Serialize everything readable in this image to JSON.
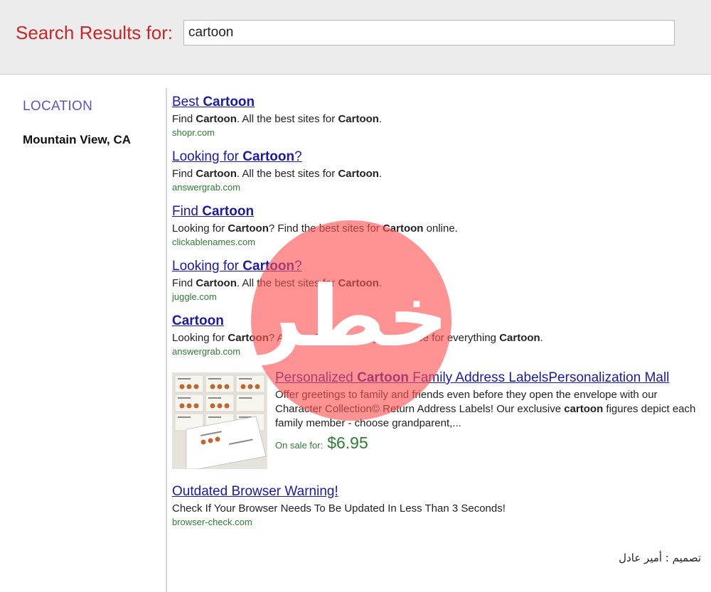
{
  "header": {
    "label": "Search Results for:",
    "query": "cartoon"
  },
  "sidebar": {
    "heading": "LOCATION",
    "location": "Mountain View, CA"
  },
  "results": [
    {
      "title_parts": [
        "Best ",
        "Cartoon",
        ""
      ],
      "desc": [
        [
          "Find ",
          false
        ],
        [
          "Cartoon",
          true
        ],
        [
          ". All the best sites for ",
          false
        ],
        [
          "Cartoon",
          true
        ],
        [
          ".",
          false
        ]
      ],
      "url": "shopr.com"
    },
    {
      "title_parts": [
        "Looking for ",
        "Cartoon",
        "?"
      ],
      "desc": [
        [
          "Find ",
          false
        ],
        [
          "Cartoon",
          true
        ],
        [
          ". All the best sites for ",
          false
        ],
        [
          "Cartoon",
          true
        ],
        [
          ".",
          false
        ]
      ],
      "url": "answergrab.com"
    },
    {
      "title_parts": [
        "Find ",
        "Cartoon",
        ""
      ],
      "desc": [
        [
          "Looking for ",
          false
        ],
        [
          "Cartoon",
          true
        ],
        [
          "? Find the best sites for ",
          false
        ],
        [
          "Cartoon",
          true
        ],
        [
          " online.",
          false
        ]
      ],
      "url": "clickablenames.com"
    },
    {
      "title_parts": [
        "Looking for ",
        "Cartoon",
        "?"
      ],
      "desc": [
        [
          "Find ",
          false
        ],
        [
          "Cartoon",
          true
        ],
        [
          ". All the best sites for ",
          false
        ],
        [
          "Cartoon",
          true
        ],
        [
          ".",
          false
        ]
      ],
      "url": "juggle.com"
    },
    {
      "title_parts": [
        "",
        "Cartoon",
        ""
      ],
      "desc": [
        [
          "Looking for ",
          false
        ],
        [
          "Cartoon",
          true
        ],
        [
          "? AnswerGrab.com is your source for everything ",
          false
        ],
        [
          "Cartoon",
          true
        ],
        [
          ".",
          false
        ]
      ],
      "url": "answergrab.com"
    }
  ],
  "product": {
    "title_parts": [
      "Personalized ",
      "Cartoon",
      " Family Address LabelsPersonalization Mall"
    ],
    "desc": [
      [
        "Offer greetings to family and friends even before they open the envelope with our Character Collection© Return Address Labels! Our exclusive ",
        false
      ],
      [
        "cartoon",
        true
      ],
      [
        " figures depict each family member - choose grandparent,...",
        false
      ]
    ],
    "sale_label": "On sale for:",
    "price": "$6.95"
  },
  "warning": {
    "title": "Outdated Browser Warning!",
    "desc": "Check If Your Browser Needs To Be Updated In Less Than 3 Seconds!",
    "url": "browser-check.com"
  },
  "watermark": {
    "text": "خطر",
    "color": "#ff5050"
  },
  "credit": "تصميم : أمير عادل",
  "colors": {
    "label_red": "#c62828",
    "link_blue": "#1a1aa6",
    "url_green": "#2e7d32",
    "heading_purple": "#5b55c9"
  }
}
